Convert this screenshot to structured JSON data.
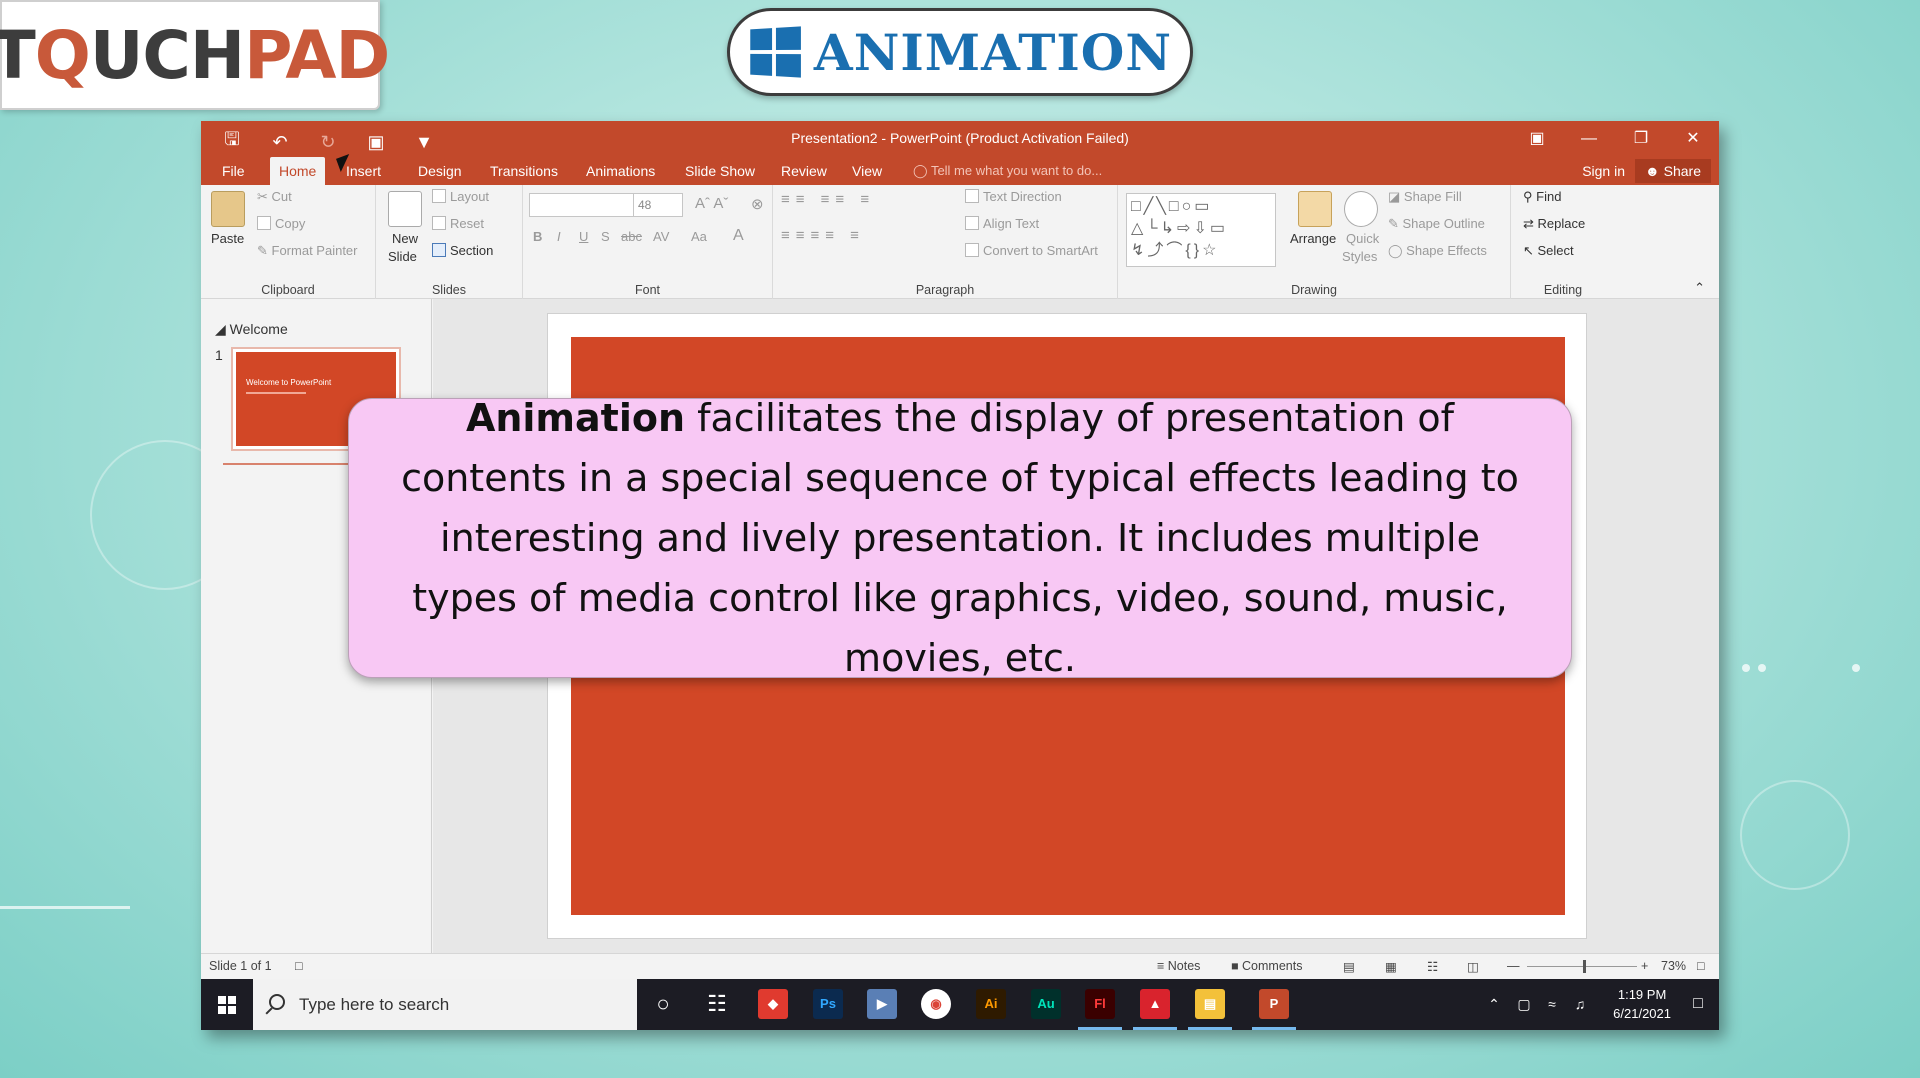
{
  "logo": {
    "part1": "T",
    "part2": "Q",
    "part3": "UCH",
    "part4": "PAD"
  },
  "banner": {
    "title": "ANIMATION"
  },
  "window": {
    "title": "Presentation2 - PowerPoint (Product Activation Failed)",
    "tabs": [
      "File",
      "Home",
      "Insert",
      "Design",
      "Transitions",
      "Animations",
      "Slide Show",
      "Review",
      "View"
    ],
    "active_tab": "Home",
    "tell_me": "Tell me what you want to do...",
    "sign_in": "Sign in",
    "share": "Share"
  },
  "ribbon": {
    "clipboard": {
      "label": "Clipboard",
      "paste": "Paste",
      "cut": "Cut",
      "copy": "Copy",
      "format_painter": "Format Painter"
    },
    "slides": {
      "label": "Slides",
      "new_slide_1": "New",
      "new_slide_2": "Slide",
      "layout": "Layout",
      "reset": "Reset",
      "section": "Section"
    },
    "font": {
      "label": "Font",
      "size": "48",
      "bold": "B",
      "italic": "I",
      "underline": "U",
      "shadow": "S",
      "strike": "abc",
      "spacing": "AV",
      "case": "Aa"
    },
    "paragraph": {
      "label": "Paragraph",
      "text_direction": "Text Direction",
      "align_text": "Align Text",
      "convert": "Convert to SmartArt"
    },
    "drawing": {
      "label": "Drawing",
      "arrange": "Arrange",
      "quick_styles_1": "Quick",
      "quick_styles_2": "Styles",
      "shape_fill": "Shape Fill",
      "shape_outline": "Shape Outline",
      "shape_effects": "Shape Effects"
    },
    "editing": {
      "label": "Editing",
      "find": "Find",
      "replace": "Replace",
      "select": "Select"
    }
  },
  "left_pane": {
    "section": "Welcome",
    "slide_number": "1",
    "thumb_title": "Welcome to PowerPoint"
  },
  "status": {
    "slide_info": "Slide 1 of 1",
    "notes": "Notes",
    "comments": "Comments",
    "zoom": "73%"
  },
  "taskbar": {
    "search_placeholder": "Type here to search",
    "time": "1:19 PM",
    "date": "6/21/2021",
    "apps": [
      "Ps",
      "Ai",
      "Au",
      "Fl"
    ]
  },
  "callout": {
    "bold": "Animation",
    "text": " facilitates the display of presentation of contents in a special sequence of typical effects leading to interesting and lively presentation. It includes multiple types of media control like graphics, video, sound, music, movies, etc."
  }
}
